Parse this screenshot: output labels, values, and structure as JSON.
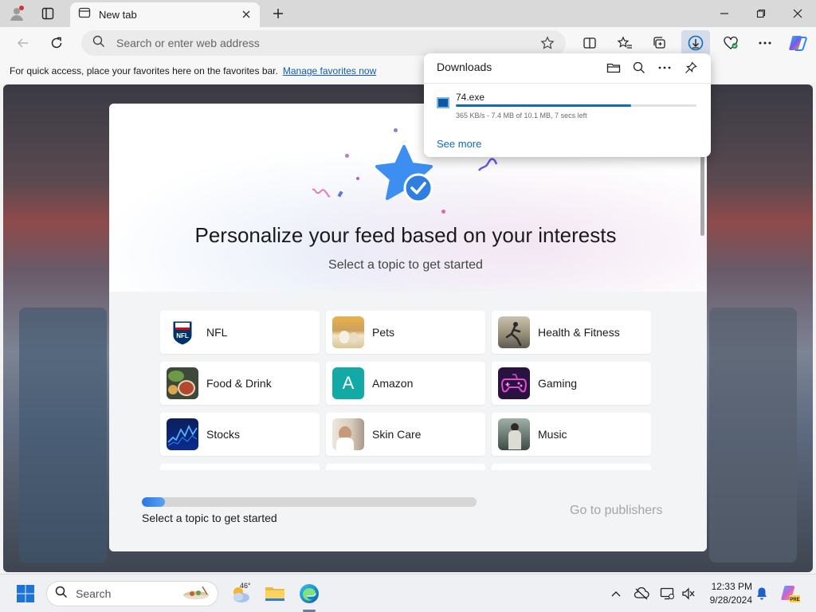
{
  "browser": {
    "tab_title": "New tab",
    "address_placeholder": "Search or enter web address"
  },
  "favorites_bar": {
    "message": "For quick access, place your favorites here on the favorites bar.",
    "link": "Manage favorites now"
  },
  "onboarding": {
    "title": "Personalize your feed based on your interests",
    "subtitle": "Select a topic to get started",
    "topics": [
      {
        "label": "NFL"
      },
      {
        "label": "Pets"
      },
      {
        "label": "Health & Fitness"
      },
      {
        "label": "Food & Drink"
      },
      {
        "label": "Amazon",
        "letter": "A"
      },
      {
        "label": "Gaming"
      },
      {
        "label": "Stocks"
      },
      {
        "label": "Skin Care"
      },
      {
        "label": "Music"
      }
    ],
    "progress_label": "Select a topic to get started",
    "progress_fraction": 0.07,
    "next_label": "Go to publishers"
  },
  "downloads": {
    "title": "Downloads",
    "file_name": "74.exe",
    "status": "365 KB/s - 7.4 MB of 10.1 MB, 7 secs left",
    "progress_fraction": 0.73,
    "see_more": "See more"
  },
  "taskbar": {
    "search_label": "Search",
    "weather_temp": "46°",
    "time": "12:33 PM",
    "date": "9/28/2024"
  },
  "colors": {
    "accent": "#0f6cbd",
    "amazon_tile": "#13a9a6"
  }
}
